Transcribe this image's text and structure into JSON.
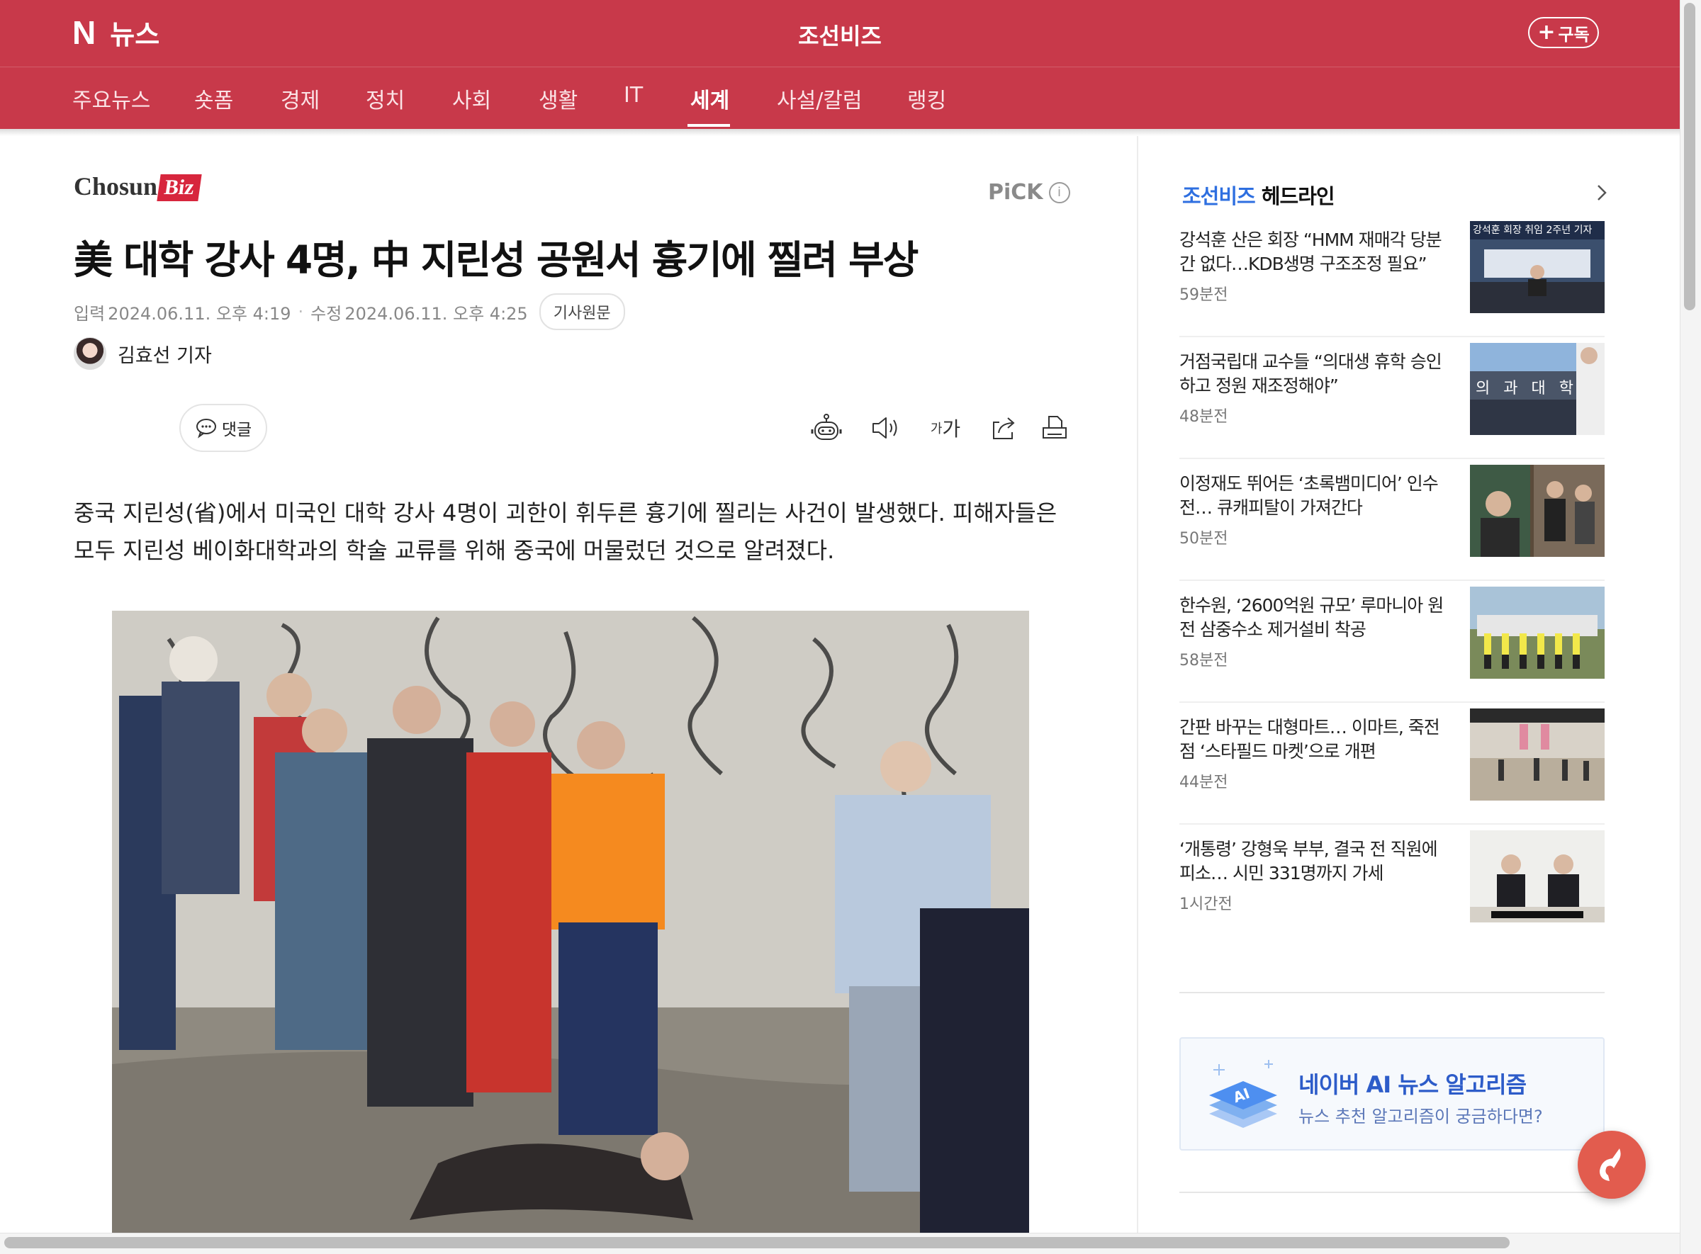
{
  "header": {
    "brand_mark": "N",
    "brand_label": "뉴스",
    "press_name": "조선비즈",
    "subscribe_plus": "+",
    "subscribe_label": "구독",
    "background_color": "#c8394a"
  },
  "nav": {
    "items": [
      {
        "label": "주요뉴스"
      },
      {
        "label": "숏폼"
      },
      {
        "label": "경제"
      },
      {
        "label": "정치"
      },
      {
        "label": "사회"
      },
      {
        "label": "생활"
      },
      {
        "label": "IT"
      },
      {
        "label": "세계"
      },
      {
        "label": "사설/칼럼"
      },
      {
        "label": "랭킹"
      }
    ],
    "active": "세계"
  },
  "article": {
    "press_logo_main": "Chosun",
    "press_logo_sub": "Biz",
    "pick_label": "PiCK",
    "pick_info_icon": "i",
    "headline": "美 대학 강사 4명, 中 지린성 공원서 흉기에 찔려 부상",
    "input_label": "입력",
    "input_time": "2024.06.11. 오후 4:19",
    "edit_label": "수정",
    "edit_time": "2024.06.11. 오후 4:25",
    "original_button": "기사원문",
    "reporter": "김효선 기자",
    "comment_button": "댓글",
    "font_tool_small": "가",
    "font_tool_large": "가",
    "lead": "중국 지린성(省)에서 미국인 대학 강사 4명이 괴한이 휘두른 흉기에 찔리는 사건이 발생했다. 피해자들은 모두 지린성 베이화대학과의 학술 교류를 위해 중국에 머물렀던 것으로 알려졌다.",
    "photo_icon": "news-photo"
  },
  "sidebar": {
    "title_press": "조선비즈",
    "title_rest": " 헤드라인",
    "items": [
      {
        "title": "강석훈 산은 회장 “HMM 재매각 당분간 없다…KDB생명 구조조정 필요”",
        "time": "59분전",
        "thumb_caption": "강석훈 회장 취임 2주년 기자"
      },
      {
        "title": "거점국립대 교수들 “의대생 휴학 승인하고 정원 재조정해야”",
        "time": "48분전",
        "thumb_caption": "의 과 대 학"
      },
      {
        "title": "이정재도 뛰어든 ‘초록뱀미디어’ 인수전… 큐캐피탈이 가져간다",
        "time": "50분전",
        "thumb_caption": ""
      },
      {
        "title": "한수원, ‘2600억원 규모’ 루마니아 원전 삼중수소 제거설비 착공",
        "time": "58분전",
        "thumb_caption": ""
      },
      {
        "title": "간판 바꾸는 대형마트… 이마트, 죽전점 ‘스타필드 마켓’으로 개편",
        "time": "44분전",
        "thumb_caption": ""
      },
      {
        "title": "‘개통령’ 강형욱 부부, 결국 전 직원에 피소… 시민 331명까지 가세",
        "time": "1시간전",
        "thumb_caption": ""
      }
    ],
    "ai_box": {
      "icon_text": "AI",
      "title": "네이버 AI 뉴스 알고리즘",
      "subtitle": "뉴스 추천 알고리즘이 궁금하다면?"
    }
  },
  "colors": {
    "brand": "#c8394a",
    "press_blue": "#2e6fe0",
    "ai_blue": "#2d5cc9",
    "fab": "#e25c4e"
  }
}
